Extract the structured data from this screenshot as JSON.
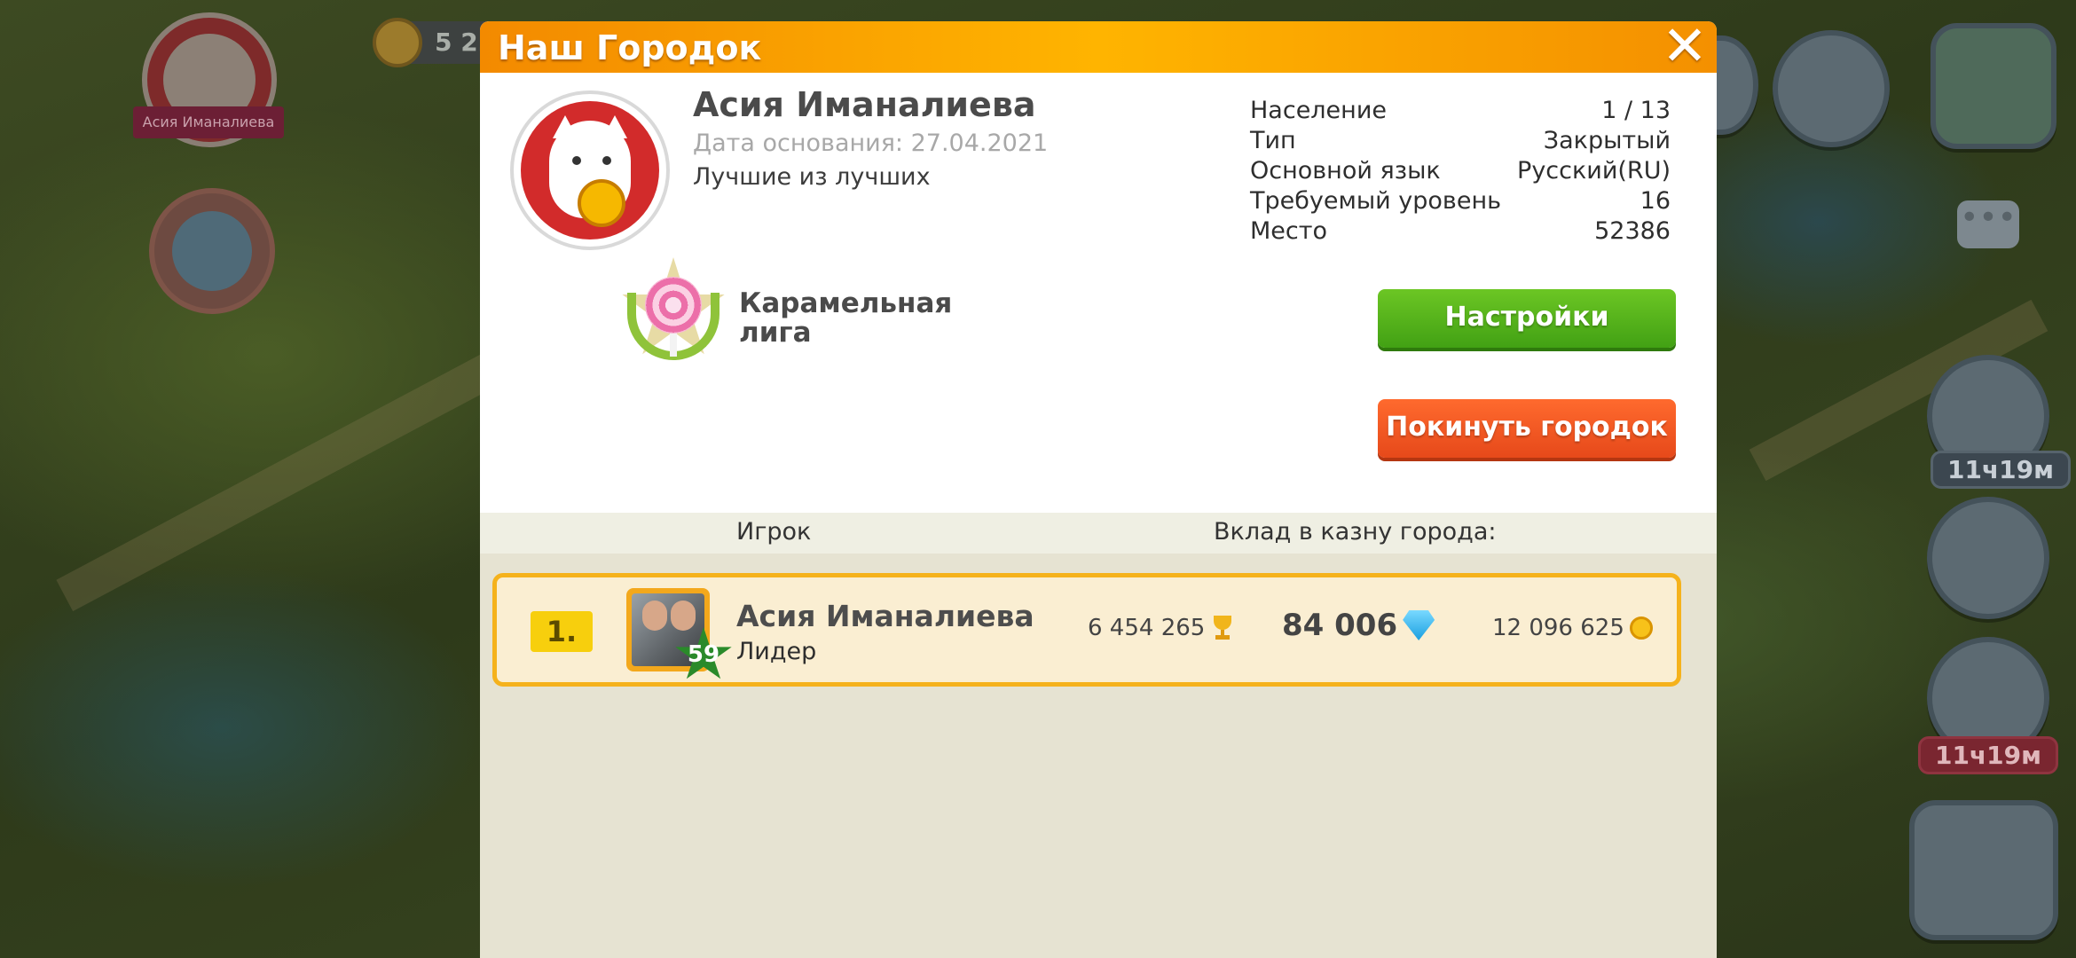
{
  "hud": {
    "city_badge_label": "Асия Иманалиева",
    "coins_partial": "5 22",
    "timer_1": "11ч19м",
    "timer_2": "11ч19м"
  },
  "modal": {
    "title": "Наш Городок",
    "close_symbol": "✕",
    "town": {
      "name": "Асия Иманалиева",
      "founded": "Дата основания: 27.04.2021",
      "motto": "Лучшие из лучших"
    },
    "stats": [
      {
        "label": "Население",
        "value": "1 / 13"
      },
      {
        "label": "Тип",
        "value": "Закрытый"
      },
      {
        "label": "Основной язык",
        "value": "Русский(RU)"
      },
      {
        "label": "Требуемый уровень",
        "value": "16"
      },
      {
        "label": "Место",
        "value": "52386"
      }
    ],
    "league": "Карамельная лига",
    "buttons": {
      "settings": "Настройки",
      "leave": "Покинуть городок"
    },
    "table": {
      "col_player": "Игрок",
      "col_contribution": "Вклад в казну города:",
      "rows": [
        {
          "rank": "1.",
          "level": "59",
          "name": "Асия Иманалиева",
          "role": "Лидер",
          "trophies": "6 454 265",
          "gems": "84 006",
          "coins": "12 096 625"
        }
      ]
    }
  },
  "colors": {
    "header_orange": "#f7a000",
    "button_green": "#55b31d",
    "button_red": "#f15a24",
    "row_highlight_border": "#f5b21c",
    "rank_badge": "#f7cf0d"
  },
  "icons": [
    "close-icon",
    "trophy-icon",
    "gem-icon",
    "coin-icon",
    "level-star-icon",
    "league-candy-icon",
    "chat-icon"
  ]
}
